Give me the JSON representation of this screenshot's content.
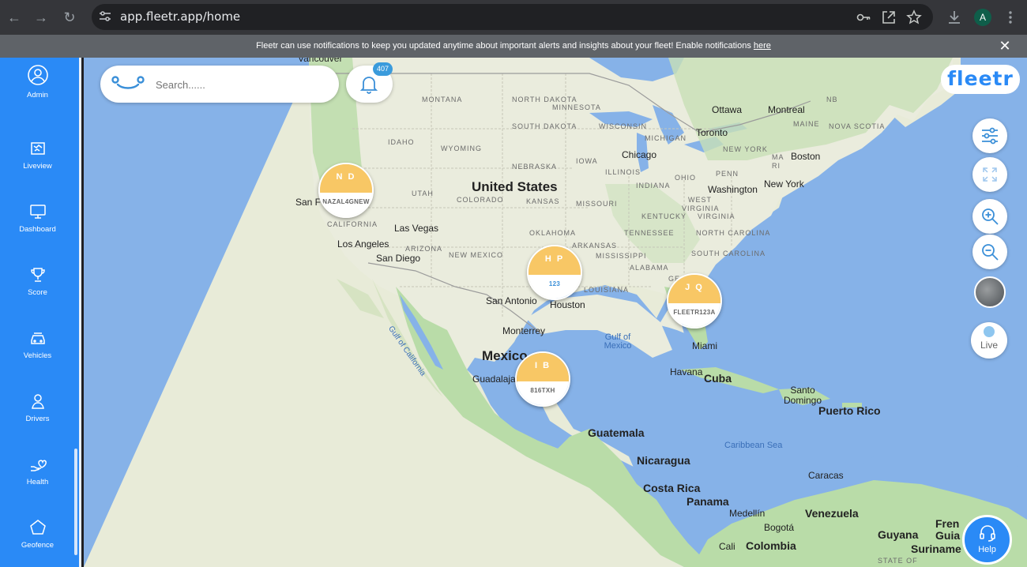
{
  "browser": {
    "url": "app.fleetr.app/home",
    "avatar_initial": "A"
  },
  "notification": {
    "text": "Fleetr can use notifications to keep you updated anytime about important alerts and insights about your fleet! Enable notifications ",
    "link": "here"
  },
  "sidebar": {
    "items": [
      {
        "label": "Admin",
        "icon": "user-circle-icon"
      },
      {
        "label": "Liveview",
        "icon": "map-icon"
      },
      {
        "label": "Dashboard",
        "icon": "monitor-icon"
      },
      {
        "label": "Score",
        "icon": "trophy-icon"
      },
      {
        "label": "Vehicles",
        "icon": "car-icon"
      },
      {
        "label": "Drivers",
        "icon": "person-icon"
      },
      {
        "label": "Health",
        "icon": "heart-hand-icon"
      },
      {
        "label": "Geofence",
        "icon": "pentagon-icon"
      }
    ]
  },
  "search": {
    "placeholder": "Search......"
  },
  "notifications_count": "407",
  "brand": "fleetr",
  "controls": {
    "live_label": "Live",
    "help_label": "Help"
  },
  "markers": [
    {
      "initials": "N D",
      "plate": "NAZAL4GNEW"
    },
    {
      "initials": "H P",
      "plate": "123"
    },
    {
      "initials": "J Q",
      "plate": "FLEETR123A"
    },
    {
      "initials": "I B",
      "plate": "816TXH"
    }
  ],
  "map_labels": {
    "vancouver": "Vancouver",
    "montana": "MONTANA",
    "north_dakota": "NORTH DAKOTA",
    "minnesota": "MINNESOTA",
    "ottawa": "Ottawa",
    "montreal": "Montreal",
    "nb": "NB",
    "south_dakota": "SOUTH DAKOTA",
    "wisconsin": "WISCONSIN",
    "maine": "MAINE",
    "nova_scotia": "NOVA SCOTIA",
    "idaho": "IDAHO",
    "wyoming": "WYOMING",
    "michigan": "MICHIGAN",
    "toronto": "Toronto",
    "chicago": "Chicago",
    "iowa": "IOWA",
    "new_york_state": "NEW YORK",
    "ma": "MA",
    "boston": "Boston",
    "ri": "RI",
    "nebraska": "NEBRASKA",
    "illinois": "ILLINOIS",
    "ohio": "OHIO",
    "pennsylvania": "PENN",
    "united_states": "United States",
    "utah": "UTAH",
    "indiana": "INDIANA",
    "washington": "Washington",
    "new_york": "New York",
    "san_francisco": "San F",
    "colorado": "COLORADO",
    "kansas": "KANSAS",
    "missouri": "MISSOURI",
    "west_virginia": "WEST",
    "virginia_short": "VIRGINIA",
    "kentucky": "KENTUCKY",
    "virginia": "VIRGINIA",
    "california": "CALIFORNIA",
    "las_vegas": "Las Vegas",
    "oklahoma": "OKLAHOMA",
    "tennessee": "TENNESSEE",
    "north_carolina": "NORTH CAROLINA",
    "los_angeles": "Los Angeles",
    "arizona": "ARIZONA",
    "arkansas": "ARKANSAS",
    "san_diego": "San Diego",
    "new_mexico": "NEW MEXICO",
    "mississippi": "MISSISSIPPI",
    "south_carolina": "SOUTH CAROLINA",
    "alabama": "ALABAMA",
    "ge": "GE",
    "louisiana": "LOUISIANA",
    "san_antonio": "San Antonio",
    "houston": "Houston",
    "gulf_of_california": "Gulf of California",
    "monterrey": "Monterrey",
    "gulf_of_mexico": "Gulf of Mexico",
    "miami": "Miami",
    "mexico": "Mexico",
    "havana": "Havana",
    "cuba": "Cuba",
    "guadalajara": "Guadalajara",
    "santo_domingo": "Santo Domingo",
    "puerto_rico": "Puerto Rico",
    "guatemala": "Guatemala",
    "caribbean_sea": "Caribbean Sea",
    "nicaragua": "Nicaragua",
    "costa_rica": "Costa Rica",
    "panama": "Panama",
    "caracas": "Caracas",
    "medellin": "Medellín",
    "venezuela": "Venezuela",
    "bogota": "Bogotá",
    "guyana": "Guyana",
    "suriname": "Suriname",
    "french_guiana": "Fren Guia",
    "cali": "Cali",
    "colombia": "Colombia",
    "state_of": "STATE OF"
  },
  "colors": {
    "sidebar": "#2a8af6",
    "marker_top": "#f8c765",
    "water": "#86b2e8",
    "land": "#e7ecd9"
  }
}
